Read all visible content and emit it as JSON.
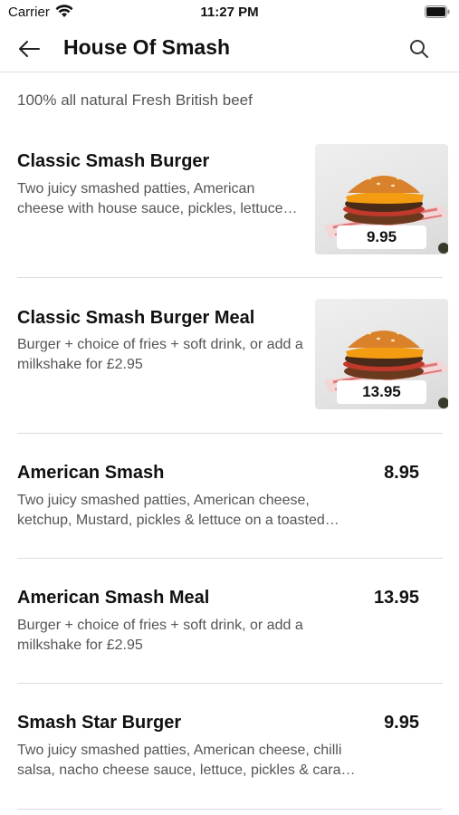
{
  "status_bar": {
    "carrier": "Carrier",
    "time": "11:27 PM",
    "wifi_icon": "wifi-icon",
    "battery_icon": "battery-icon"
  },
  "header": {
    "title": "House Of Smash",
    "back_icon": "arrow-left-icon",
    "search_icon": "search-icon"
  },
  "category": {
    "description": "100% all natural Fresh British beef"
  },
  "items": [
    {
      "name": "Classic Smash Burger",
      "description": "Two juicy smashed patties, American cheese with house sauce, pickles, lettuce…",
      "price": "9.95",
      "image": "burger-image"
    },
    {
      "name": "Classic Smash Burger Meal",
      "description": "Burger + choice of fries + soft drink, or add a milkshake for £2.95",
      "price": "13.95",
      "image": "burger-image"
    },
    {
      "name": "American Smash",
      "description": "Two juicy smashed patties, American cheese, ketchup, Mustard, pickles & lettuce on a toasted…",
      "price": "8.95"
    },
    {
      "name": "American Smash Meal",
      "description": "Burger + choice of fries + soft drink, or add a milkshake for £2.95",
      "price": "13.95"
    },
    {
      "name": "Smash Star Burger",
      "description": "Two juicy smashed patties, American cheese, chilli salsa, nacho cheese sauce, lettuce, pickles & cara…",
      "price": "9.95"
    }
  ]
}
